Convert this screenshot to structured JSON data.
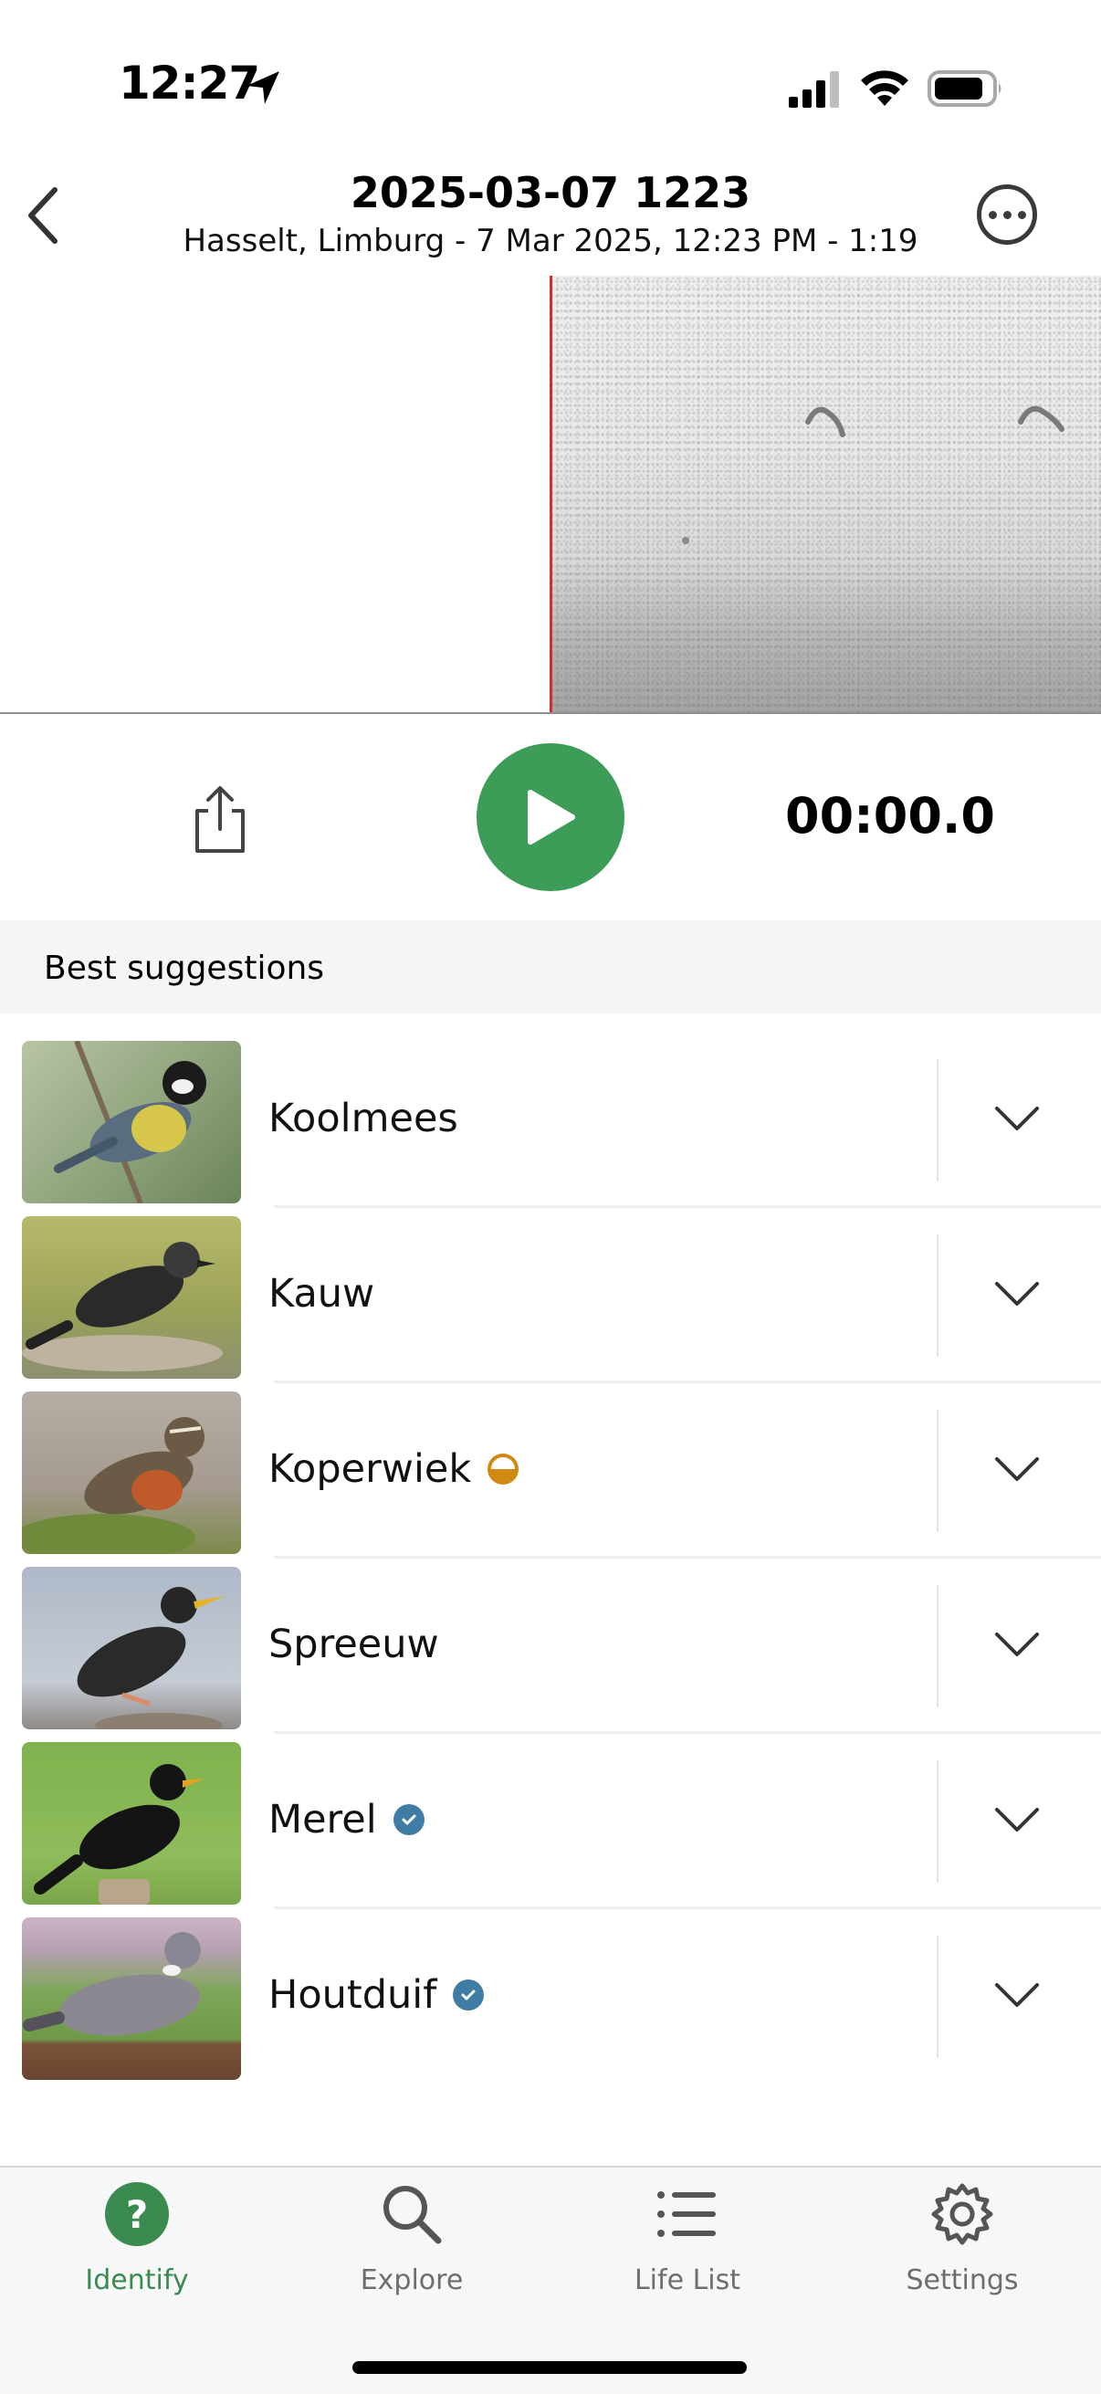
{
  "status_bar": {
    "time": "12:27"
  },
  "header": {
    "title": "2025-03-07 1223",
    "subtitle": "Hasselt, Limburg - 7 Mar 2025, 12:23 PM - 1:19"
  },
  "player": {
    "time": "00:00.0",
    "play_color": "#3d9d58"
  },
  "section": {
    "title": "Best suggestions"
  },
  "suggestions": [
    {
      "name": "Koolmees",
      "badge": "none",
      "icon": "great-tit-photo"
    },
    {
      "name": "Kauw",
      "badge": "none",
      "icon": "jackdaw-photo"
    },
    {
      "name": "Koperwiek",
      "badge": "half-circle",
      "icon": "redwing-photo"
    },
    {
      "name": "Spreeuw",
      "badge": "none",
      "icon": "starling-photo"
    },
    {
      "name": "Merel",
      "badge": "verified",
      "icon": "blackbird-photo"
    },
    {
      "name": "Houtduif",
      "badge": "verified",
      "icon": "wood-pigeon-photo"
    }
  ],
  "tabs": [
    {
      "label": "Identify",
      "icon": "question-icon",
      "active": true
    },
    {
      "label": "Explore",
      "icon": "search-icon",
      "active": false
    },
    {
      "label": "Life List",
      "icon": "list-icon",
      "active": false
    },
    {
      "label": "Settings",
      "icon": "gear-icon",
      "active": false
    }
  ],
  "colors": {
    "accent": "#3b8a4f",
    "playhead": "#d0302b",
    "half_badge": "#d08a12",
    "verified_badge": "#3f7da6"
  }
}
